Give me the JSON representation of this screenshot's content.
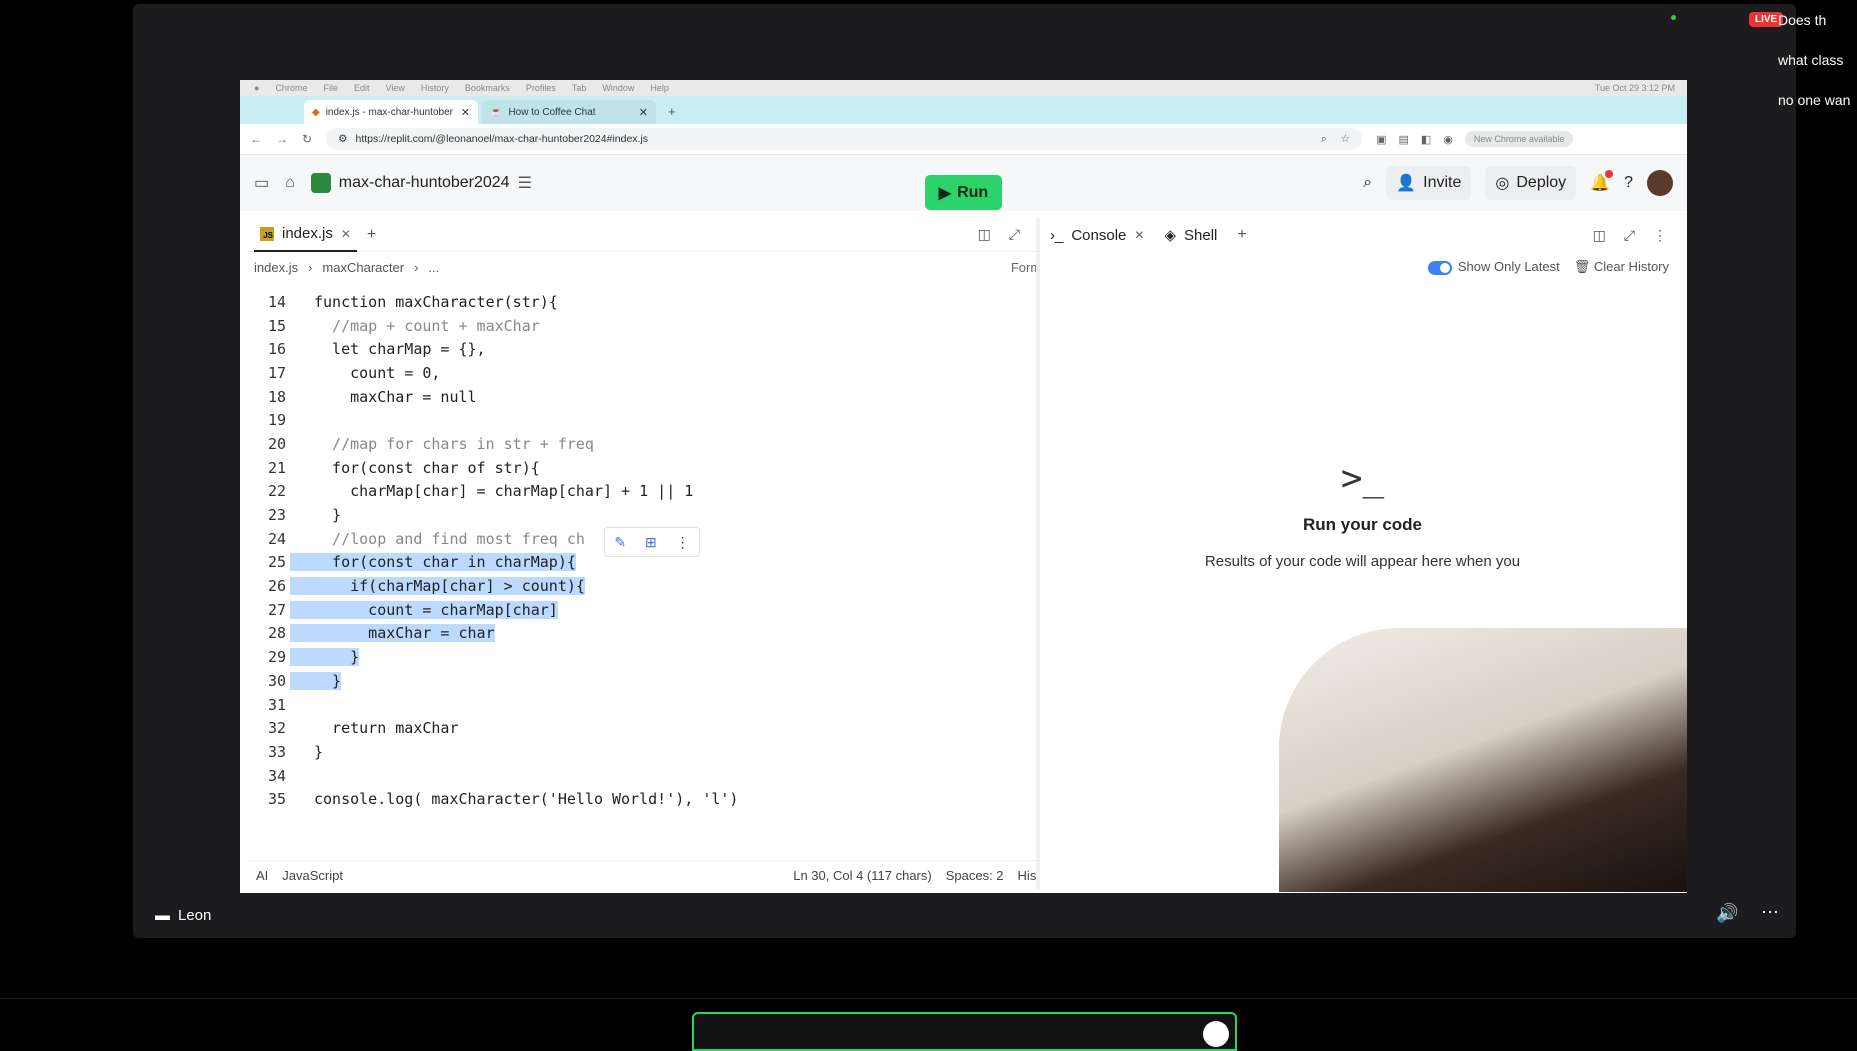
{
  "mac_menu": {
    "app": "Chrome",
    "items": [
      "File",
      "Edit",
      "View",
      "History",
      "Bookmarks",
      "Profiles",
      "Tab",
      "Window",
      "Help"
    ],
    "clock": "Tue Oct 29 3:12 PM"
  },
  "browser": {
    "tabs": [
      {
        "title": "index.js - max-char-huntober",
        "active": true
      },
      {
        "title": "How to Coffee Chat",
        "active": false
      }
    ],
    "url": "https://replit.com/@leonanoel/max-char-huntober2024#index.js",
    "update_label": "New Chrome available"
  },
  "replit": {
    "repl_name": "max-char-huntober2024",
    "run_label": "Run",
    "invite_label": "Invite",
    "deploy_label": "Deploy"
  },
  "editor": {
    "file_tab": "index.js",
    "breadcrumb": [
      "index.js",
      "maxCharacter",
      "..."
    ],
    "format_label": "Format",
    "lines": [
      {
        "n": "14",
        "text": "function maxCharacter(str){"
      },
      {
        "n": "15",
        "text": "  //map + count + maxChar"
      },
      {
        "n": "16",
        "text": "  let charMap = {},"
      },
      {
        "n": "17",
        "text": "    count = 0,"
      },
      {
        "n": "18",
        "text": "    maxChar = null"
      },
      {
        "n": "19",
        "text": ""
      },
      {
        "n": "20",
        "text": "  //map for chars in str + freq"
      },
      {
        "n": "21",
        "text": "  for(const char of str){"
      },
      {
        "n": "22",
        "text": "    charMap[char] = charMap[char] + 1 || 1"
      },
      {
        "n": "23",
        "text": "  }"
      },
      {
        "n": "24",
        "text": "  //loop and find most freq ch"
      },
      {
        "n": "25",
        "text": "  for(const char in charMap){"
      },
      {
        "n": "26",
        "text": "    if(charMap[char] > count){"
      },
      {
        "n": "27",
        "text": "      count = charMap[char]"
      },
      {
        "n": "28",
        "text": "      maxChar = char"
      },
      {
        "n": "29",
        "text": "    }"
      },
      {
        "n": "30",
        "text": "  }"
      },
      {
        "n": "31",
        "text": ""
      },
      {
        "n": "32",
        "text": "  return maxChar"
      },
      {
        "n": "33",
        "text": "}"
      },
      {
        "n": "34",
        "text": ""
      },
      {
        "n": "35",
        "text": "console.log( maxCharacter('Hello World!'), 'l')"
      }
    ],
    "footer": {
      "ai": "AI",
      "lang": "JavaScript",
      "pos": "Ln 30, Col 4 (117 chars)",
      "spaces": "Spaces: 2",
      "history": "History"
    }
  },
  "console": {
    "tabs": [
      "Console",
      "Shell"
    ],
    "show_latest": "Show Only Latest",
    "clear_history": "Clear History",
    "prompt": ">_",
    "title": "Run your code",
    "message": "Results of your code will appear here when you"
  },
  "stream": {
    "presenter": "Leon",
    "live_badge": "LIVE",
    "chat": [
      "Does th",
      "what class",
      "no one wan"
    ]
  }
}
